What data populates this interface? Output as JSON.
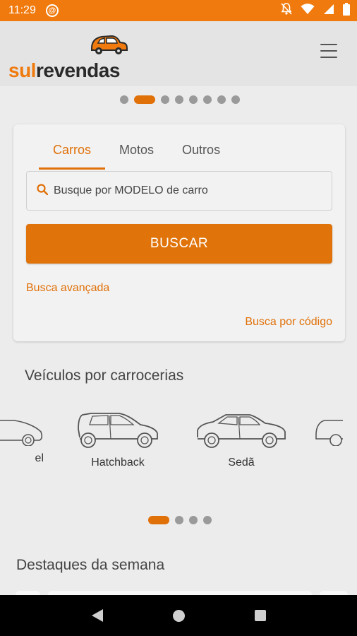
{
  "status_bar": {
    "time": "11:29"
  },
  "brand": {
    "name_prefix": "sul",
    "name_suffix": "revendas"
  },
  "carousel_top": {
    "total": 8,
    "active_index": 1
  },
  "search": {
    "tabs": [
      {
        "label": "Carros",
        "active": true
      },
      {
        "label": "Motos",
        "active": false
      },
      {
        "label": "Outros",
        "active": false
      }
    ],
    "placeholder": "Busque por MODELO de carro",
    "button_label": "BUSCAR",
    "advanced_link": "Busca avançada",
    "code_link": "Busca por código"
  },
  "body_types": {
    "title": "Veículos por carrocerias",
    "items": [
      {
        "label": "el",
        "icon": "car-partial-icon"
      },
      {
        "label": "Hatchback",
        "icon": "hatchback-car-icon"
      },
      {
        "label": "Sedã",
        "icon": "sedan-car-icon"
      },
      {
        "label": "",
        "icon": "car-partial-icon"
      }
    ]
  },
  "carousel_mid": {
    "total": 4,
    "active_index": 0
  },
  "highlights": {
    "title": "Destaques da semana"
  },
  "colors": {
    "accent": "#e07008",
    "status_bar": "#f07a0d",
    "background": "#ececec"
  }
}
